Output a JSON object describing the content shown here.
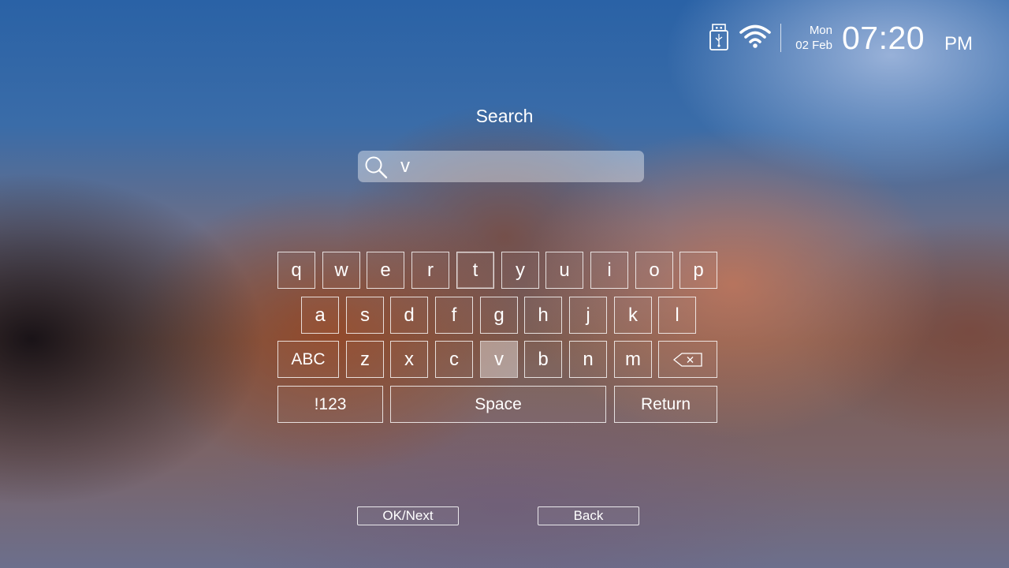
{
  "status": {
    "day": "Mon",
    "date": "02 Feb",
    "time": "07:20",
    "ampm": "PM",
    "icons": [
      "usb-icon",
      "wifi-icon"
    ]
  },
  "search": {
    "title": "Search",
    "query": "v",
    "icon": "search-icon"
  },
  "keyboard": {
    "row1": [
      "q",
      "w",
      "e",
      "r",
      "t",
      "y",
      "u",
      "i",
      "o",
      "p"
    ],
    "row2": [
      "a",
      "s",
      "d",
      "f",
      "g",
      "h",
      "j",
      "k",
      "l"
    ],
    "row3": [
      "z",
      "x",
      "c",
      "v",
      "b",
      "n",
      "m"
    ],
    "abc_label": "ABC",
    "symbols_label": "!123",
    "space_label": "Space",
    "return_label": "Return",
    "backspace_icon": "backspace-icon",
    "selected_key": "v"
  },
  "buttons": {
    "ok_next": "OK/Next",
    "back": "Back"
  }
}
